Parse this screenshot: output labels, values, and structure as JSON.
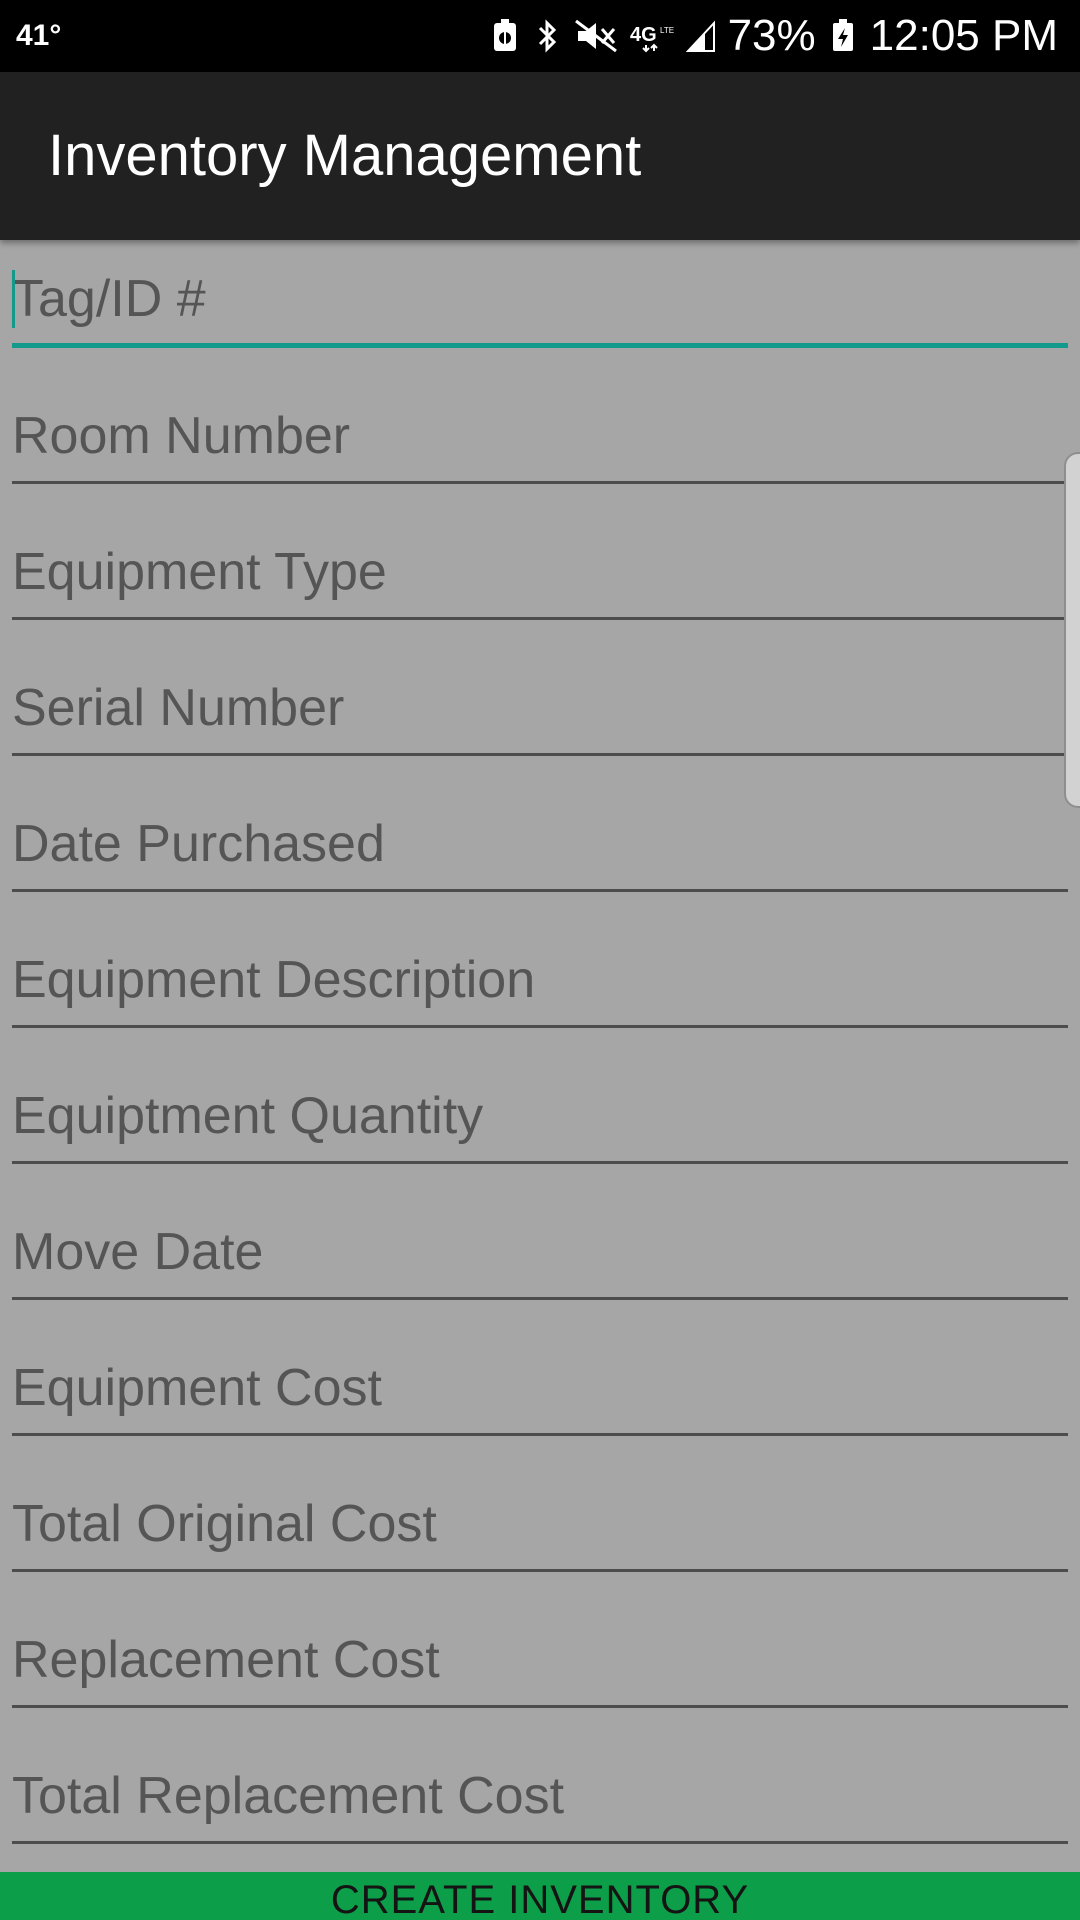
{
  "status_bar": {
    "temperature": "41°",
    "battery_percent": "73%",
    "time": "12:05 PM",
    "icons": [
      "battery-saver-icon",
      "bluetooth-icon",
      "vibrate-mute-icon",
      "4g-lte-icon",
      "signal-icon",
      "battery-charging-icon"
    ]
  },
  "app_bar": {
    "title": "Inventory Management"
  },
  "form": {
    "fields": [
      {
        "placeholder": "Tag/ID #",
        "value": "",
        "focused": true
      },
      {
        "placeholder": "Room Number",
        "value": ""
      },
      {
        "placeholder": "Equipment Type",
        "value": ""
      },
      {
        "placeholder": "Serial Number",
        "value": ""
      },
      {
        "placeholder": "Date Purchased",
        "value": ""
      },
      {
        "placeholder": "Equipment Description",
        "value": ""
      },
      {
        "placeholder": "Equiptment Quantity",
        "value": ""
      },
      {
        "placeholder": "Move Date",
        "value": ""
      },
      {
        "placeholder": "Equipment Cost",
        "value": ""
      },
      {
        "placeholder": "Total Original Cost",
        "value": ""
      },
      {
        "placeholder": "Replacement Cost",
        "value": ""
      },
      {
        "placeholder": "Total Replacement Cost",
        "value": ""
      }
    ]
  },
  "create_button": {
    "label": "CREATE INVENTORY"
  },
  "colors": {
    "status_bar": "#000000",
    "app_bar": "#212121",
    "background": "#a6a6a6",
    "focus_accent": "#139a8c",
    "button": "#0c9e48"
  }
}
